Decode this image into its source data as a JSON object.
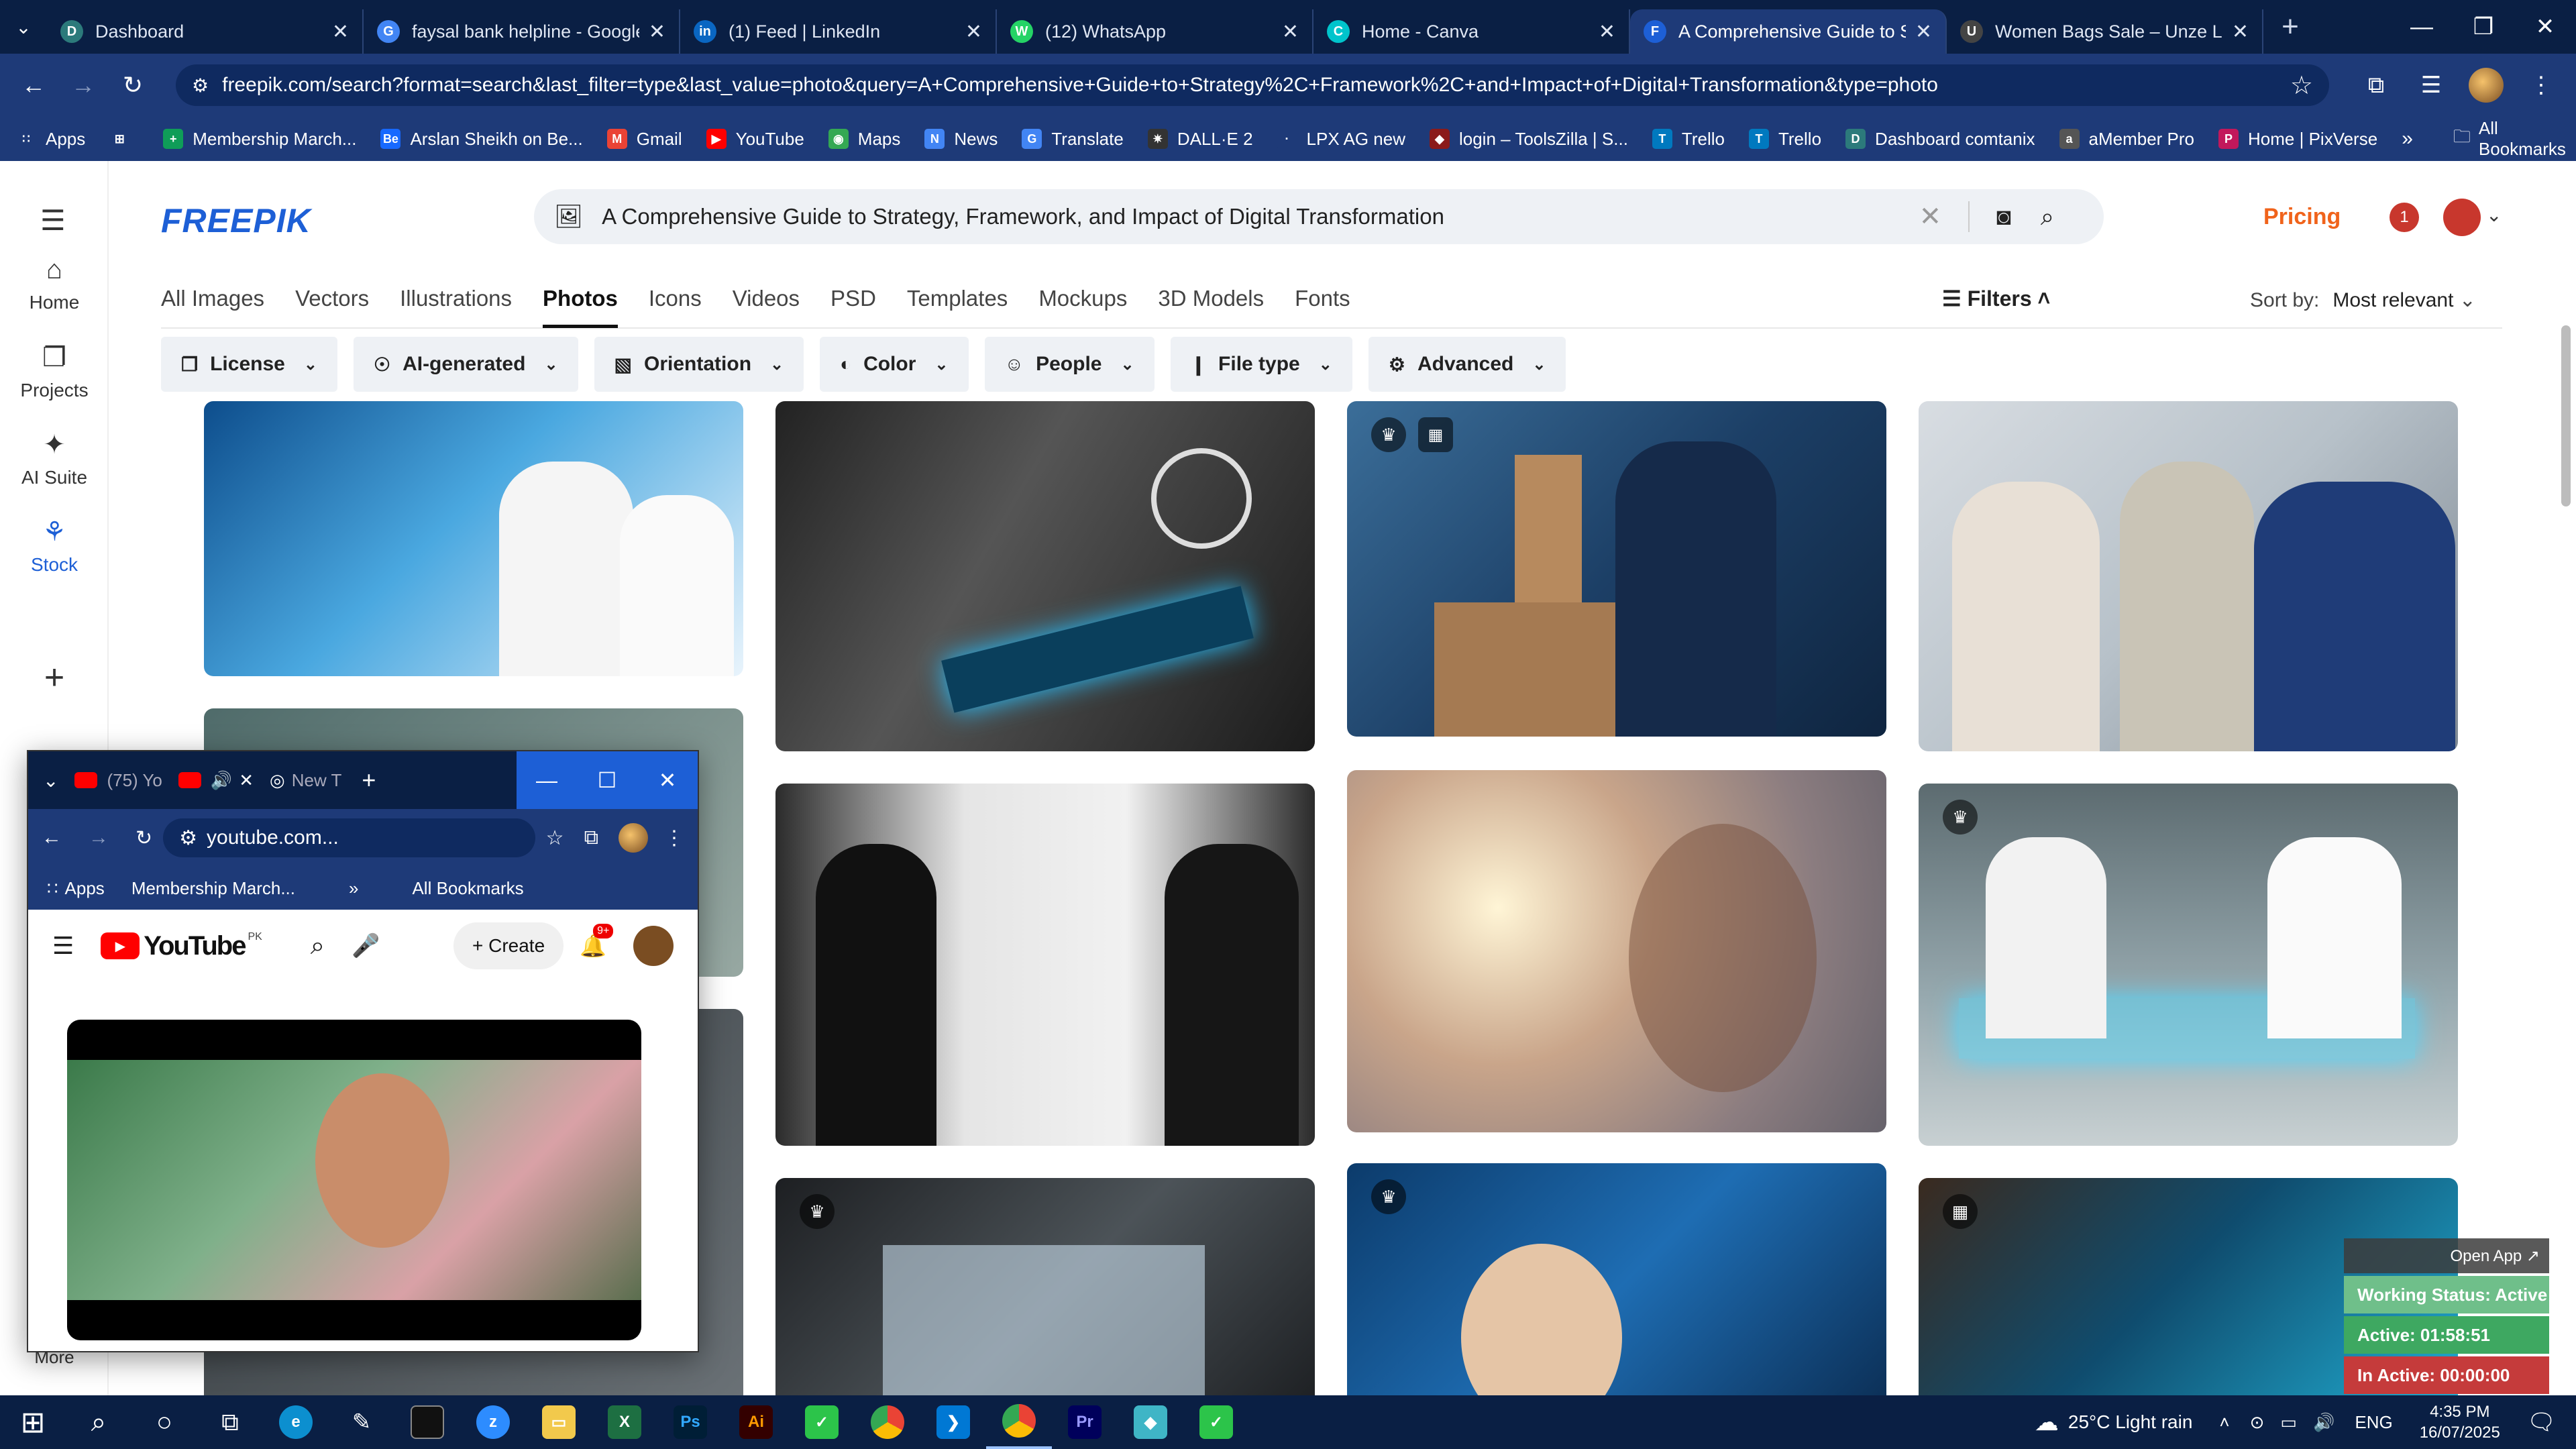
{
  "browser": {
    "tabs": [
      {
        "title": "Dashboard",
        "favicon": "dashboard-favicon",
        "color": "#2c7a7b",
        "glyph": "D",
        "active": false
      },
      {
        "title": "faysal bank helpline - Google S",
        "favicon": "google-favicon",
        "color": "#4285f4",
        "glyph": "G",
        "active": false
      },
      {
        "title": "(1) Feed | LinkedIn",
        "favicon": "linkedin-favicon",
        "color": "#0a66c2",
        "glyph": "in",
        "active": false
      },
      {
        "title": "(12) WhatsApp",
        "favicon": "whatsapp-favicon",
        "color": "#25d366",
        "glyph": "W",
        "active": false
      },
      {
        "title": "Home - Canva",
        "favicon": "canva-favicon",
        "color": "#00c4cc",
        "glyph": "C",
        "active": false
      },
      {
        "title": "A Comprehensive Guide to Stra",
        "favicon": "freepik-favicon",
        "color": "#1d5fd6",
        "glyph": "F",
        "active": true
      },
      {
        "title": "Women Bags Sale – Unze Lond",
        "favicon": "unze-favicon",
        "color": "#444444",
        "glyph": "U",
        "active": false
      }
    ],
    "url": "freepik.com/search?format=search&last_filter=type&last_value=photo&query=A+Comprehensive+Guide+to+Strategy%2C+Framework%2C+and+Impact+of+Digital+Transformation&type=photo",
    "bookmarks": [
      {
        "label": "Apps",
        "color": "#1e3a78",
        "glyph": "∷"
      },
      {
        "label": "",
        "color": "#1e3a78",
        "glyph": "⊞"
      },
      {
        "label": "Membership March...",
        "color": "#0f9d58",
        "glyph": "+"
      },
      {
        "label": "Arslan Sheikh on Be...",
        "color": "#1769ff",
        "glyph": "Be"
      },
      {
        "label": "Gmail",
        "color": "#ea4335",
        "glyph": "M"
      },
      {
        "label": "YouTube",
        "color": "#ff0000",
        "glyph": "▶"
      },
      {
        "label": "Maps",
        "color": "#34a853",
        "glyph": "◉"
      },
      {
        "label": "News",
        "color": "#4285f4",
        "glyph": "N"
      },
      {
        "label": "Translate",
        "color": "#4285f4",
        "glyph": "G"
      },
      {
        "label": "DALL·E 2",
        "color": "#333333",
        "glyph": "✷"
      },
      {
        "label": "LPX AG new",
        "color": "#1e3a78",
        "glyph": "·"
      },
      {
        "label": "login – ToolsZilla | S...",
        "color": "#8b1a1a",
        "glyph": "◆"
      },
      {
        "label": "Trello",
        "color": "#0079bf",
        "glyph": "T"
      },
      {
        "label": "Trello",
        "color": "#0079bf",
        "glyph": "T"
      },
      {
        "label": "Dashboard comtanix",
        "color": "#2c7a7b",
        "glyph": "D"
      },
      {
        "label": "aMember Pro",
        "color": "#555555",
        "glyph": "a"
      },
      {
        "label": "Home | PixVerse",
        "color": "#c2185b",
        "glyph": "P"
      }
    ],
    "all_bookmarks": "All Bookmarks"
  },
  "freepik": {
    "logo": "FREEPIK",
    "search_query": "A Comprehensive Guide to Strategy, Framework, and Impact of Digital Transformation",
    "pricing": "Pricing",
    "notification_count": "1",
    "left_nav": [
      {
        "label": "Home",
        "icon": "home-icon",
        "glyph": "⌂"
      },
      {
        "label": "Projects",
        "icon": "projects-icon",
        "glyph": "❐"
      },
      {
        "label": "AI Suite",
        "icon": "ai-suite-icon",
        "glyph": "✦"
      },
      {
        "label": "Stock",
        "icon": "stock-icon",
        "glyph": "⚘"
      }
    ],
    "more": "More",
    "content_tabs": [
      "All Images",
      "Vectors",
      "Illustrations",
      "Photos",
      "Icons",
      "Videos",
      "PSD",
      "Templates",
      "Mockups",
      "3D Models",
      "Fonts"
    ],
    "active_tab": "Photos",
    "filters_label": "Filters",
    "sort_label": "Sort by:",
    "sort_value": "Most relevant",
    "filter_chips": [
      {
        "label": "License",
        "glyph": "❐"
      },
      {
        "label": "AI-generated",
        "glyph": "☉"
      },
      {
        "label": "Orientation",
        "glyph": "▧"
      },
      {
        "label": "Color",
        "glyph": "◐"
      },
      {
        "label": "People",
        "glyph": "☺"
      },
      {
        "label": "File type",
        "glyph": "❙"
      },
      {
        "label": "Advanced",
        "glyph": "⚙"
      }
    ]
  },
  "popup": {
    "tabs": [
      {
        "title": "(75) Yo"
      },
      {
        "title": ""
      },
      {
        "title": "New T"
      }
    ],
    "url": "youtube.com...",
    "bookmarks": [
      "Apps",
      "Membership March..."
    ],
    "all_bookmarks": "All Bookmarks",
    "yt_region": "PK",
    "create": "Create",
    "notifications": "9+"
  },
  "widget": {
    "open_app": "Open App ↗",
    "working_status": "Working Status: Active",
    "active": "Active: 01:58:51",
    "inactive": "In Active: 00:00:00"
  },
  "taskbar": {
    "weather": "25°C  Light rain",
    "lang": "ENG",
    "time": "4:35 PM",
    "date": "16/07/2025"
  }
}
